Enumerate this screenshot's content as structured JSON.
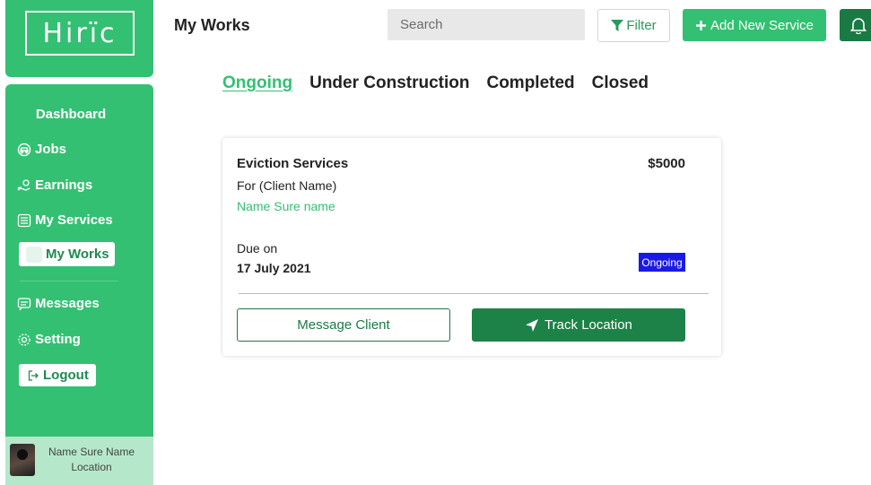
{
  "app": {
    "logo_text": "Hirïc"
  },
  "sidebar": {
    "title": "Dashboard",
    "items": [
      {
        "label": "Jobs",
        "icon": "car-icon"
      },
      {
        "label": "Earnings",
        "icon": "money-hand-icon"
      },
      {
        "label": "My Services",
        "icon": "list-icon"
      },
      {
        "label": "My Works",
        "icon": "works-icon",
        "active": true
      },
      {
        "label": "Messages",
        "icon": "message-icon"
      },
      {
        "label": "Setting",
        "icon": "gear-icon"
      },
      {
        "label": "Logout",
        "icon": "logout-icon"
      }
    ],
    "profile": {
      "name": "Name Sure Name",
      "location": "Location"
    }
  },
  "header": {
    "title": "My Works",
    "search_placeholder": "Search",
    "filter_label": "Filter",
    "add_label": "Add New Service"
  },
  "tabs": [
    {
      "label": "Ongoing",
      "active": true
    },
    {
      "label": "Under Construction"
    },
    {
      "label": "Completed"
    },
    {
      "label": "Closed"
    }
  ],
  "card": {
    "service": "Eviction Services",
    "price": "$5000",
    "for_label": "For (Client Name)",
    "client_name": "Name Sure name",
    "due_label": "Due on",
    "due_date": "17 July 2021",
    "status": "Ongoing",
    "message_button": "Message Client",
    "track_button": "Track Location"
  },
  "colors": {
    "brand_green": "#33c072",
    "dark_green": "#1c8247",
    "status_blue": "#1a1ae6"
  }
}
